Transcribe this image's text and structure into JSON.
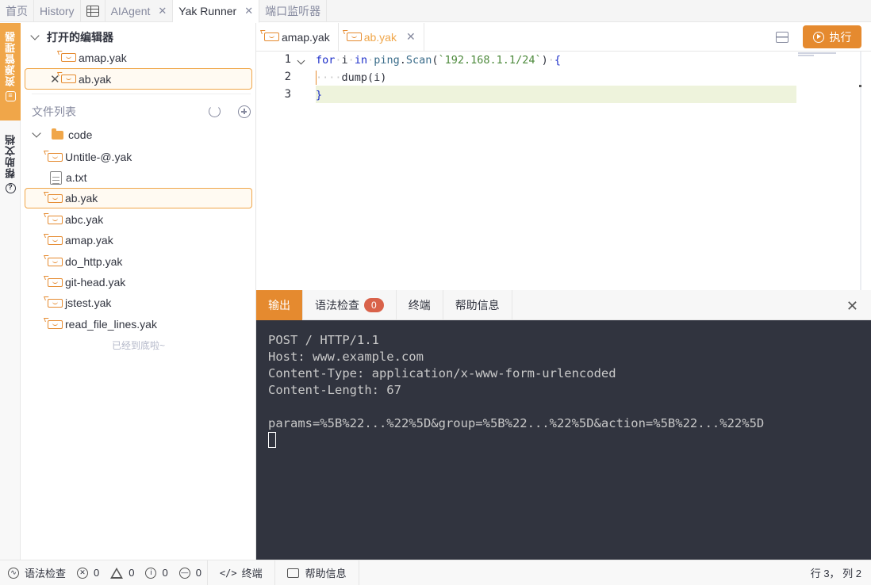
{
  "top_tabs": [
    {
      "label": "首页"
    },
    {
      "label": "History"
    },
    {
      "label": "AIAgent"
    },
    {
      "label": "Yak Runner"
    },
    {
      "label": "端口监听器"
    }
  ],
  "rail": {
    "explorer_label": "资源管理器",
    "help_label": "帮助文档"
  },
  "sidebar": {
    "open_editors_title": "打开的编辑器",
    "open_editors": [
      {
        "name": "amap.yak"
      },
      {
        "name": "ab.yak"
      }
    ],
    "file_list_title": "文件列表",
    "folder": "code",
    "files": [
      {
        "name": "Untitle-@.yak"
      },
      {
        "name": "a.txt"
      },
      {
        "name": "ab.yak"
      },
      {
        "name": "abc.yak"
      },
      {
        "name": "amap.yak"
      },
      {
        "name": "do_http.yak"
      },
      {
        "name": "git-head.yak"
      },
      {
        "name": "jstest.yak"
      },
      {
        "name": "read_file_lines.yak"
      }
    ],
    "end_text": "已经到底啦~"
  },
  "editor": {
    "tabs": [
      {
        "label": "amap.yak"
      },
      {
        "label": "ab.yak"
      }
    ],
    "run_label": "执行",
    "line_numbers": [
      "1",
      "2",
      "3"
    ],
    "code": {
      "l1_for": "for",
      "l1_i": "i",
      "l1_in": "in",
      "l1_ping": "ping",
      "l1_scan": "Scan",
      "l1_str": "`192.168.1.1/24`",
      "l2_call": "dump(i)",
      "l3": "}"
    }
  },
  "panel": {
    "tabs": [
      {
        "label": "输出"
      },
      {
        "label": "语法检查"
      },
      {
        "label": "终端"
      },
      {
        "label": "帮助信息"
      }
    ],
    "syntax_count": "0",
    "output_lines": [
      "POST / HTTP/1.1",
      "Host: www.example.com",
      "Content-Type: application/x-www-form-urlencoded",
      "Content-Length: 67",
      "",
      "params=%5B%22...%22%5D&group=%5B%22...%22%5D&action=%5B%22...%22%5D"
    ]
  },
  "status_bar": {
    "syntax_label": "语法检查",
    "errors": "0",
    "warnings": "0",
    "infos": "0",
    "hints": "0",
    "terminal_label": "终端",
    "help_label": "帮助信息",
    "cursor_pos": "行 3， 列 2"
  },
  "colors": {
    "accent": "#e58a2f",
    "terminal_bg": "#31343f",
    "badge": "#d9624a"
  }
}
